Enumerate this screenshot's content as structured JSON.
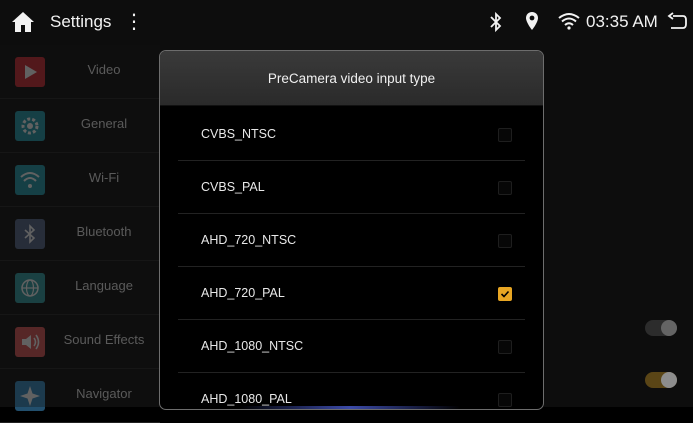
{
  "statusbar": {
    "title": "Settings",
    "menu_glyph": "⋮",
    "time": "03:35 AM",
    "icons": [
      "home-icon",
      "more-vert-icon",
      "bluetooth-icon",
      "location-icon",
      "wifi-icon",
      "back-icon"
    ]
  },
  "sidebar": {
    "items": [
      {
        "label": "Video",
        "icon": "play-icon",
        "color": "#d4333b"
      },
      {
        "label": "General",
        "icon": "gear-icon",
        "color": "#2a9fb0"
      },
      {
        "label": "Wi-Fi",
        "icon": "wifi-icon",
        "color": "#2a9fb0"
      },
      {
        "label": "Bluetooth",
        "icon": "bluetooth-icon",
        "color": "#5b6c8f"
      },
      {
        "label": "Language",
        "icon": "globe-icon",
        "color": "#3aa3a9"
      },
      {
        "label": "Sound Effects",
        "icon": "speaker-icon",
        "color": "#e05b5b"
      },
      {
        "label": "Navigator",
        "icon": "compass-icon",
        "color": "#3f91c7"
      }
    ]
  },
  "background_toggles": [
    {
      "state": "off"
    },
    {
      "state": "on",
      "color": "#e8a623"
    }
  ],
  "dialog": {
    "title": "PreCamera video input type",
    "options": [
      {
        "label": "CVBS_NTSC",
        "checked": false
      },
      {
        "label": "CVBS_PAL",
        "checked": false
      },
      {
        "label": "AHD_720_NTSC",
        "checked": false
      },
      {
        "label": "AHD_720_PAL",
        "checked": true
      },
      {
        "label": "AHD_1080_NTSC",
        "checked": false
      },
      {
        "label": "AHD_1080_PAL",
        "checked": false
      }
    ],
    "accent": "#e8a623"
  }
}
